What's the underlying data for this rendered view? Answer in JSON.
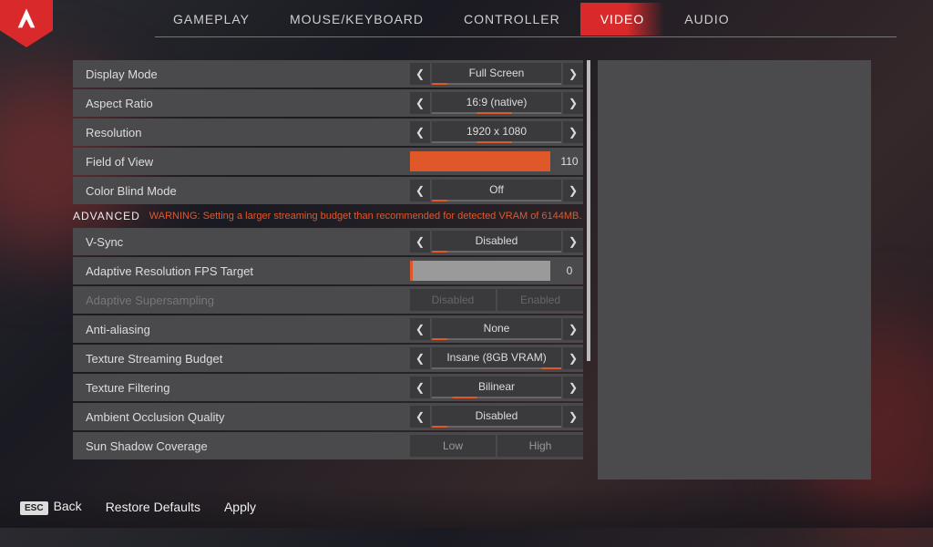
{
  "tabs": [
    "GAMEPLAY",
    "MOUSE/KEYBOARD",
    "CONTROLLER",
    "VIDEO",
    "AUDIO"
  ],
  "activeTab": 3,
  "section": {
    "label": "ADVANCED",
    "warning": "WARNING: Setting a larger streaming budget than recommended for detected VRAM of 6144MB."
  },
  "rows": [
    {
      "label": "Display Mode",
      "type": "select",
      "value": "Full Screen",
      "cls": "p3"
    },
    {
      "label": "Aspect Ratio",
      "type": "select",
      "value": "16:9 (native)",
      "cls": "p2"
    },
    {
      "label": "Resolution",
      "type": "select",
      "value": "1920 x 1080",
      "cls": "p2"
    },
    {
      "label": "Field of View",
      "type": "slider",
      "value": "110",
      "fill": 100
    },
    {
      "label": "Color Blind Mode",
      "type": "select",
      "value": "Off",
      "cls": "p3"
    },
    {
      "section": true
    },
    {
      "label": "V-Sync",
      "type": "select",
      "value": "Disabled",
      "cls": "p3"
    },
    {
      "label": "Adaptive Resolution FPS Target",
      "type": "slider",
      "value": "0",
      "fill": 2
    },
    {
      "label": "Adaptive Supersampling",
      "type": "toggle",
      "options": [
        "Disabled",
        "Enabled"
      ],
      "disabled": true
    },
    {
      "label": "Anti-aliasing",
      "type": "select",
      "value": "None",
      "cls": "p3"
    },
    {
      "label": "Texture Streaming Budget",
      "type": "select",
      "value": "Insane (8GB VRAM)",
      "cls": "p4"
    },
    {
      "label": "Texture Filtering",
      "type": "select",
      "value": "Bilinear",
      "cls": "p5"
    },
    {
      "label": "Ambient Occlusion Quality",
      "type": "select",
      "value": "Disabled",
      "cls": "p3"
    },
    {
      "label": "Sun Shadow Coverage",
      "type": "toggle",
      "options": [
        "Low",
        "High"
      ]
    }
  ],
  "footer": {
    "backKey": "ESC",
    "back": "Back",
    "restore": "Restore Defaults",
    "apply": "Apply"
  }
}
